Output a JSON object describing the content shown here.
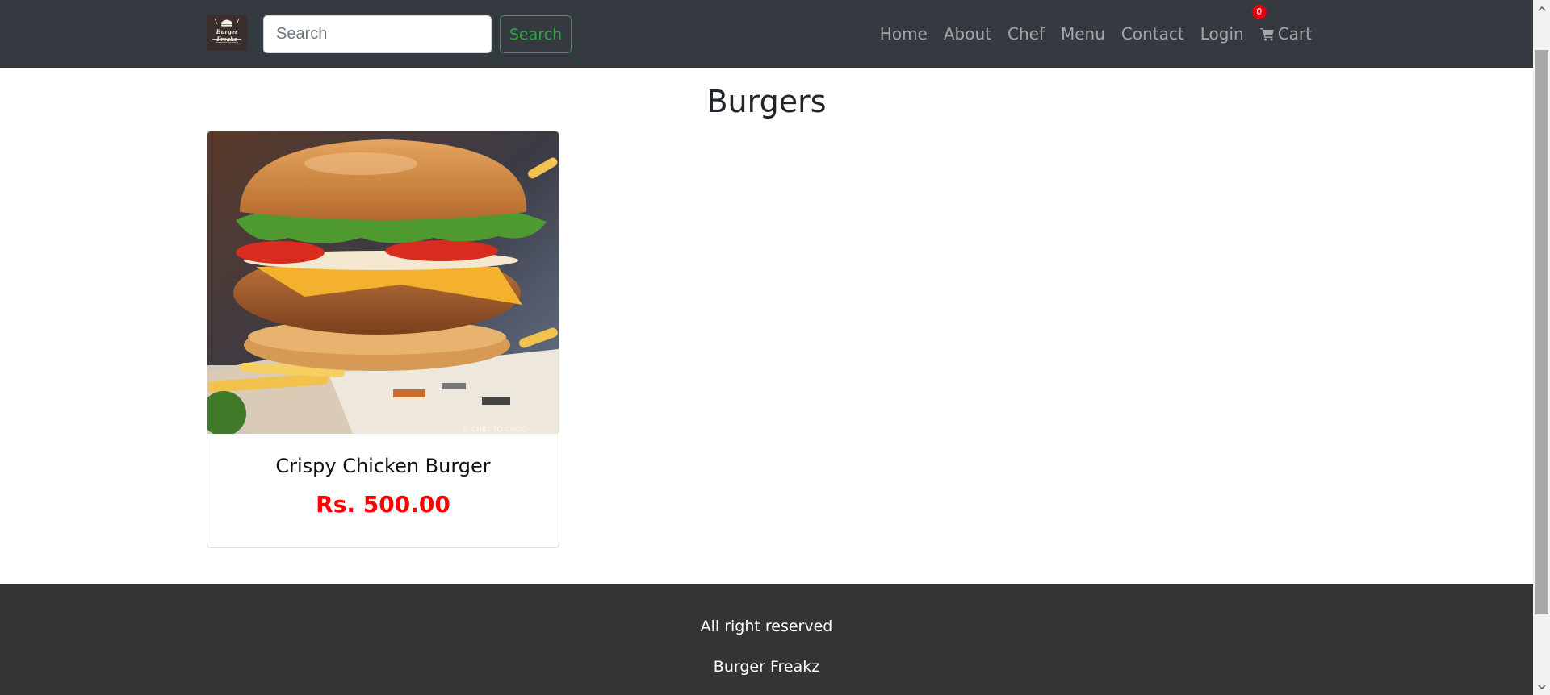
{
  "navbar": {
    "brand": {
      "logo_text": "Burger Freakz",
      "logo_icon": "burger-logo"
    },
    "search": {
      "placeholder": "Search",
      "value": "",
      "button_label": "Search"
    },
    "links": [
      "Home",
      "About",
      "Chef",
      "Menu",
      "Contact",
      "Login"
    ],
    "cart": {
      "label": "Cart",
      "count": "0",
      "icon": "cart-icon"
    }
  },
  "main": {
    "title": "Burgers",
    "products": [
      {
        "name": "Crispy Chicken Burger",
        "price": "Rs. 500.00",
        "image_icon": "burger-photo"
      }
    ]
  },
  "footer": {
    "line1": "All right reserved",
    "line2": "Burger Freakz"
  },
  "colors": {
    "navbar_bg": "#343a40",
    "footer_bg": "#343434",
    "search_button": "#28a745",
    "price": "#ff0000",
    "cart_badge": "#e0000b"
  }
}
